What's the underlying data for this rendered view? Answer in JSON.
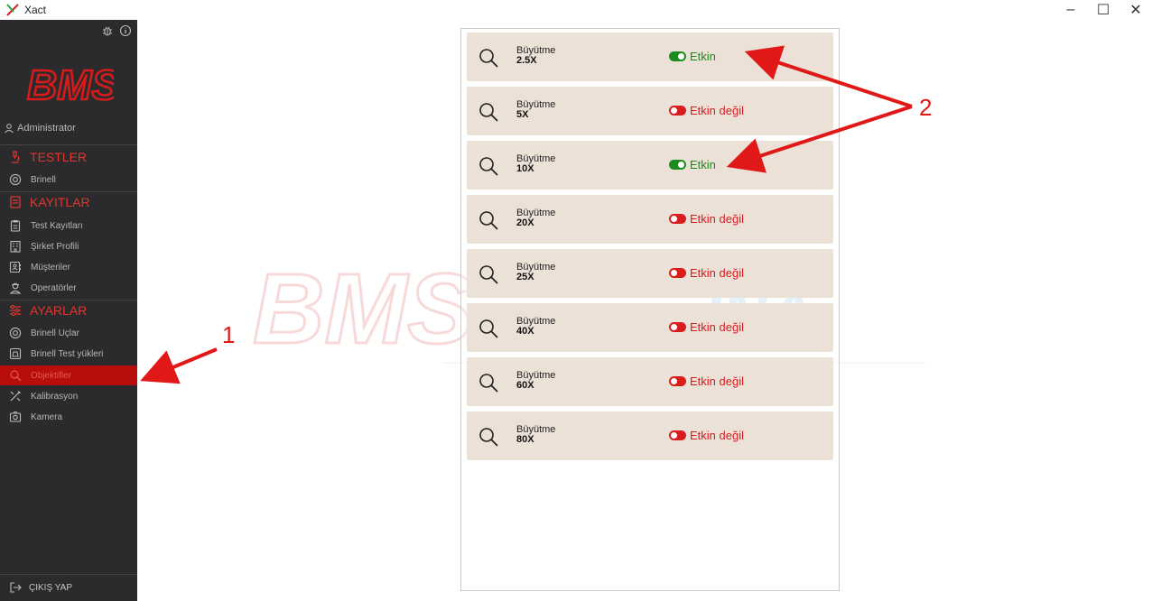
{
  "window": {
    "title": "Xact",
    "minimize": "–",
    "maximize": "☐",
    "close": "✕"
  },
  "sidebar": {
    "user": "Administrator",
    "sections": [
      {
        "label": "TESTLER",
        "icon": "microscope-icon"
      },
      {
        "label": "KAYITLAR",
        "icon": "records-icon"
      },
      {
        "label": "AYARLAR",
        "icon": "sliders-icon"
      }
    ],
    "items": [
      {
        "label": "Brinell",
        "icon": "target-icon"
      },
      {
        "label": "Test Kayıtları",
        "icon": "clipboard-icon"
      },
      {
        "label": "Şirket Profili",
        "icon": "building-icon"
      },
      {
        "label": "Müşteriler",
        "icon": "contacts-icon"
      },
      {
        "label": "Operatörler",
        "icon": "operator-icon"
      },
      {
        "label": "Brinell Uçlar",
        "icon": "target-icon"
      },
      {
        "label": "Brinell Test yükleri",
        "icon": "weight-icon"
      },
      {
        "label": "Objektifler",
        "icon": "search-icon",
        "active": true
      },
      {
        "label": "Kalibrasyon",
        "icon": "tools-icon"
      },
      {
        "label": "Kamera",
        "icon": "camera-icon"
      }
    ],
    "logout": "ÇIKIŞ YAP"
  },
  "objectives": [
    {
      "label": "Büyütme",
      "value": "2.5X",
      "enabled": true,
      "status": "Etkin"
    },
    {
      "label": "Büyütme",
      "value": "5X",
      "enabled": false,
      "status": "Etkin değil"
    },
    {
      "label": "Büyütme",
      "value": "10X",
      "enabled": true,
      "status": "Etkin"
    },
    {
      "label": "Büyütme",
      "value": "20X",
      "enabled": false,
      "status": "Etkin değil"
    },
    {
      "label": "Büyütme",
      "value": "25X",
      "enabled": false,
      "status": "Etkin değil"
    },
    {
      "label": "Büyütme",
      "value": "40X",
      "enabled": false,
      "status": "Etkin değil"
    },
    {
      "label": "Büyütme",
      "value": "60X",
      "enabled": false,
      "status": "Etkin değil"
    },
    {
      "label": "Büyütme",
      "value": "80X",
      "enabled": false,
      "status": "Etkin değil"
    }
  ],
  "annotations": {
    "one": "1",
    "two": "2"
  },
  "colors": {
    "sidebar_bg": "#2b2b2d",
    "accent_red": "#e0362c",
    "active_bg": "#b70d0d",
    "row_bg": "#ebe1d7",
    "enabled": "#1c8a1c",
    "disabled": "#d91c1c"
  }
}
